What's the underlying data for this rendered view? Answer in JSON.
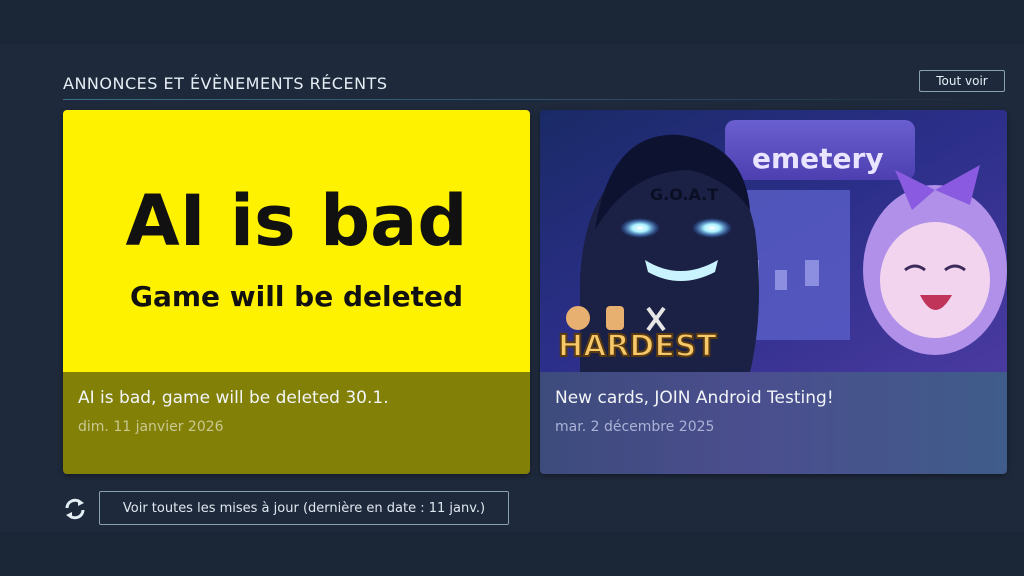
{
  "section": {
    "title": "ANNONCES ET ÉVÈNEMENTS RÉCENTS",
    "see_all_label": "Tout voir"
  },
  "cards": [
    {
      "image_headline": "AI is bad",
      "image_subline": "Game will be deleted",
      "title": "AI is bad, game will be deleted 30.1.",
      "date": "dim. 11 janvier 2026"
    },
    {
      "image_text": {
        "goat_tag": "G.O.A.T",
        "banner": "emetery",
        "logo": "HARDEST"
      },
      "title": "New cards, JOIN Android Testing!",
      "date": "mar. 2 décembre 2025"
    }
  ],
  "footer": {
    "refresh_icon": "refresh-icon",
    "updates_label": "Voir toutes les mises à jour (dernière en date : 11 janv.)"
  },
  "colors": {
    "background": "#1b2838",
    "card1_image": "#fff200",
    "card1_footer": "#838008"
  }
}
